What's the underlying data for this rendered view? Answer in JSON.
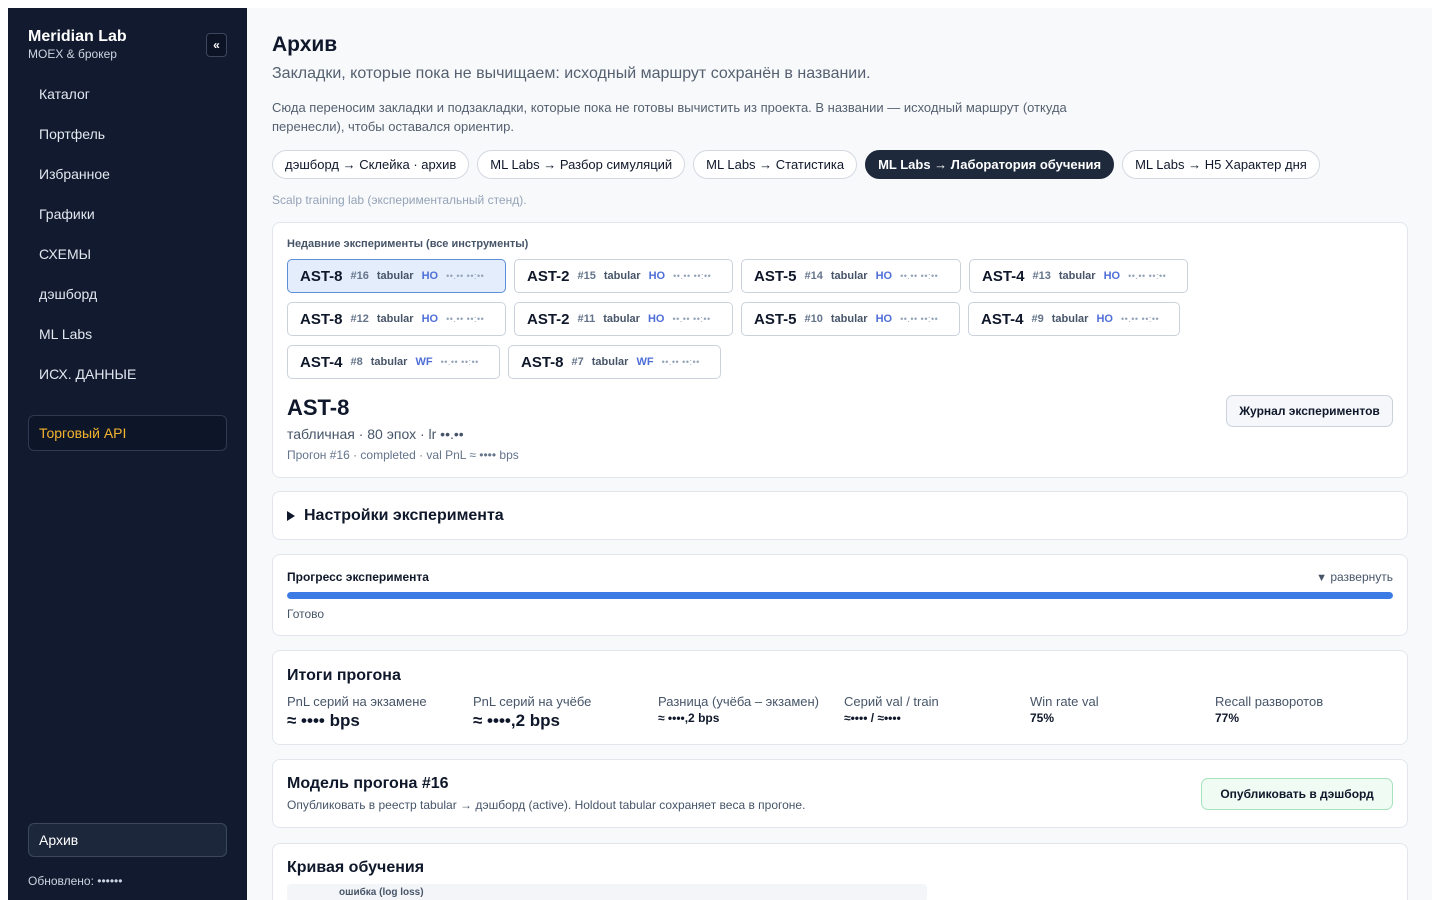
{
  "app": {
    "title": "Meridian Lab",
    "subtitle": "MOEX & брокер",
    "collapse_icon": "«"
  },
  "sidebar": {
    "items": [
      {
        "label": "Каталог"
      },
      {
        "label": "Портфель"
      },
      {
        "label": "Избранное"
      },
      {
        "label": "Графики"
      },
      {
        "label": "СХЕМЫ"
      },
      {
        "label": "дэшборд"
      },
      {
        "label": "ML Labs"
      },
      {
        "label": "ИСХ. ДАННЫЕ"
      }
    ],
    "api_button": "Торговый API",
    "archive_button": "Архив",
    "updated": "Обновлено: ••••••",
    "colors": {
      "background": "#111a2e",
      "api_accent": "#f5b32e"
    }
  },
  "page": {
    "title": "Архив",
    "subtitle": "Закладки, которые пока не вычищаем: исходный маршрут сохранён в названии.",
    "description": "Сюда переносим закладки и подзакладки, которые пока не готовы вычистить из проекта. В названии — исходный маршрут (откуда перенесли), чтобы оставался ориентир."
  },
  "tabs": [
    {
      "label": "дэшборд → Склейка · архив",
      "active": false
    },
    {
      "label": "ML Labs → Разбор симуляций",
      "active": false
    },
    {
      "label": "ML Labs → Статистика",
      "active": false
    },
    {
      "label": "ML Labs → Лаборатория обучения",
      "active": true
    },
    {
      "label": "ML Labs → H5 Характер дня",
      "active": false
    }
  ],
  "tab_note": "Scalp training lab (экспериментальный стенд).",
  "experiments": {
    "heading": "Недавние эксперименты (все инструменты)",
    "items": [
      {
        "name": "AST-8",
        "num": "#16",
        "type": "tabular",
        "tag": "HO",
        "dots": "••.•• ••:••",
        "selected": true
      },
      {
        "name": "AST-2",
        "num": "#15",
        "type": "tabular",
        "tag": "HO",
        "dots": "••.•• ••:••",
        "selected": false
      },
      {
        "name": "AST-5",
        "num": "#14",
        "type": "tabular",
        "tag": "HO",
        "dots": "••.•• ••:••",
        "selected": false
      },
      {
        "name": "AST-4",
        "num": "#13",
        "type": "tabular",
        "tag": "HO",
        "dots": "••.•• ••:••",
        "selected": false
      },
      {
        "name": "AST-8",
        "num": "#12",
        "type": "tabular",
        "tag": "HO",
        "dots": "••.•• ••:••",
        "selected": false
      },
      {
        "name": "AST-2",
        "num": "#11",
        "type": "tabular",
        "tag": "HO",
        "dots": "••.•• ••:••",
        "selected": false
      },
      {
        "name": "AST-5",
        "num": "#10",
        "type": "tabular",
        "tag": "HO",
        "dots": "••.•• ••:••",
        "selected": false
      },
      {
        "name": "AST-4",
        "num": "#9",
        "type": "tabular",
        "tag": "HO",
        "dots": "••.•• ••:••",
        "selected": false
      },
      {
        "name": "AST-4",
        "num": "#8",
        "type": "tabular",
        "tag": "WF",
        "dots": "••.•• ••:••",
        "selected": false
      },
      {
        "name": "AST-8",
        "num": "#7",
        "type": "tabular",
        "tag": "WF",
        "dots": "••.•• ••:••",
        "selected": false
      }
    ],
    "selected_name": "AST-8",
    "selected_meta": "табличная · 80 эпох · lr ••.••",
    "selected_run": "Прогон #16 · completed · val PnL ≈ •••• bps",
    "journal_button": "Журнал экспериментов"
  },
  "settings": {
    "title": "Настройки эксперимента",
    "icon": "triangle-right"
  },
  "progress": {
    "title": "Прогресс эксперимента",
    "expand": "развернуть",
    "expand_icon": "▼",
    "status": "Готово",
    "value": 1.0,
    "color": "#3b7be3"
  },
  "results": {
    "title": "Итоги прогона",
    "metrics": [
      {
        "label": "PnL серий на экзамене",
        "value": "≈ •••• bps"
      },
      {
        "label": "PnL серий на учёбе",
        "value": "≈ ••••,2 bps"
      },
      {
        "label": "Разница (учёба – экзамен)",
        "value": "≈ ••••,2 bps"
      },
      {
        "label": "Серий val / train",
        "value": "≈•••• / ≈••••"
      },
      {
        "label": "Win rate val",
        "value": "75%"
      },
      {
        "label": "Recall разворотов",
        "value": "77%"
      }
    ]
  },
  "model": {
    "title": "Модель прогона #16",
    "description": "Опубликовать в реестр tabular → дэшборд (active). Holdout tabular сохраняет веса в прогоне.",
    "publish_button": "Опубликовать в дэшборд"
  },
  "curve": {
    "title": "Кривая обучения",
    "ylabel": "ошибка (log loss)"
  }
}
